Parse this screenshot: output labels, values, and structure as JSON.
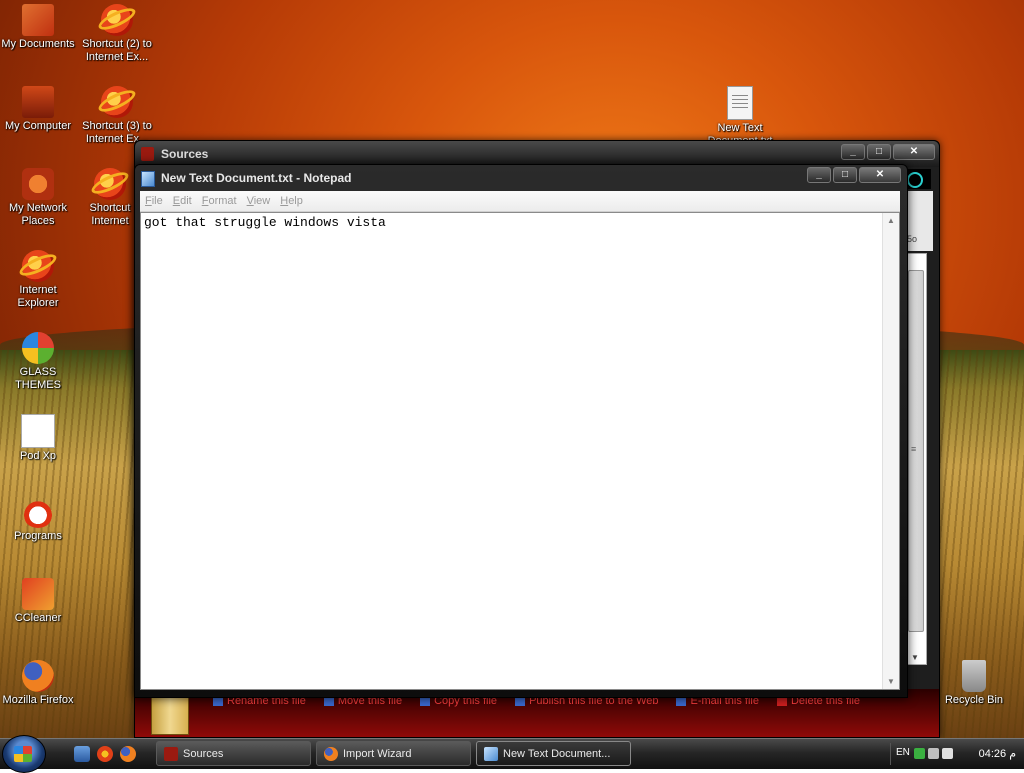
{
  "desktop": {
    "icons": [
      {
        "label": "My Documents",
        "icon": "my-documents-icon"
      },
      {
        "label": "Shortcut (2) to Internet Ex...",
        "icon": "internet-explorer-icon"
      },
      {
        "label": "My Computer",
        "icon": "my-computer-icon"
      },
      {
        "label": "Shortcut (3) to Internet Ex...",
        "icon": "internet-explorer-icon"
      },
      {
        "label": "My Network Places",
        "icon": "network-places-icon"
      },
      {
        "label": "Shortcut",
        "icon": "internet-explorer-icon"
      },
      {
        "label": "Internet Explorer",
        "icon": "internet-explorer-icon"
      },
      {
        "label": "GLASS THEMES",
        "icon": "windows-logo-icon"
      },
      {
        "label": "Pod Xp",
        "icon": "document-icon"
      },
      {
        "label": "Programs",
        "icon": "programs-icon"
      },
      {
        "label": "CCleaner",
        "icon": "ccleaner-icon"
      },
      {
        "label": "Mozilla Firefox",
        "icon": "firefox-icon"
      },
      {
        "label": "New Text Document.txt",
        "icon": "text-file-icon"
      },
      {
        "label": "Recycle Bin",
        "icon": "recycle-bin-icon"
      }
    ]
  },
  "sources_window": {
    "title": "Sources",
    "side_text": "5o",
    "tasks": [
      "Rename this file",
      "Move this file",
      "Copy this file",
      "Publish this file to the Web",
      "E-mail this file",
      "Delete this file"
    ]
  },
  "notepad": {
    "title": "New Text Document.txt - Notepad",
    "menu": [
      "File",
      "Edit",
      "Format",
      "View",
      "Help"
    ],
    "content": "got that struggle windows vista",
    "buttons": {
      "minimize": "_",
      "maximize": "□",
      "close": "✕"
    }
  },
  "taskbar": {
    "buttons": [
      {
        "label": "Sources",
        "active": false
      },
      {
        "label": "Import Wizard",
        "active": false
      },
      {
        "label": "New Text Document...",
        "active": true
      }
    ],
    "language": "EN",
    "clock": "04:26 م"
  }
}
